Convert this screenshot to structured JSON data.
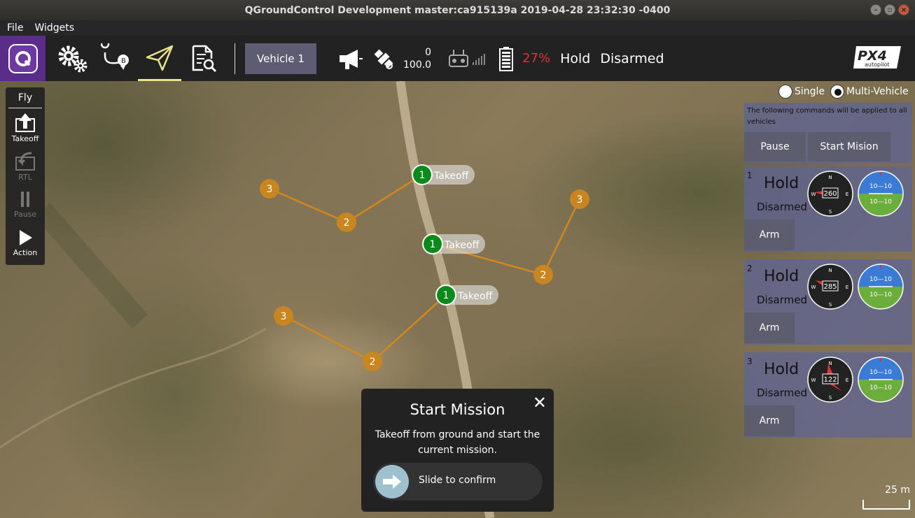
{
  "window": {
    "title": "QGroundControl Development master:ca915139a 2019-04-28 23:32:30 -0400"
  },
  "menu": {
    "file": "File",
    "widgets": "Widgets"
  },
  "toolbar": {
    "vehicle_selector": "Vehicle 1",
    "gps_count": "0",
    "gps_hdop": "100.0",
    "battery_percent": "27%",
    "flight_mode": "Hold",
    "arm_state": "Disarmed",
    "icons": [
      "qgc-logo-icon",
      "settings-gears-icon",
      "plan-route-icon",
      "fly-paper-plane-icon",
      "analyze-icon",
      "megaphone-icon",
      "gps-satellite-icon",
      "rc-transmitter-icon",
      "signal-bars-icon",
      "battery-icon",
      "px4-logo"
    ]
  },
  "flypanel": {
    "title": "Fly",
    "items": [
      {
        "label": "Takeoff",
        "icon": "takeoff-icon",
        "enabled": true
      },
      {
        "label": "RTL",
        "icon": "rtl-icon",
        "enabled": false
      },
      {
        "label": "Pause",
        "icon": "pause-icon",
        "enabled": false
      },
      {
        "label": "Action",
        "icon": "play-icon",
        "enabled": true
      }
    ]
  },
  "vehicle_mode_toggle": {
    "single": "Single",
    "multi": "Multi-Vehicle",
    "selected": "Multi-Vehicle"
  },
  "multi_vehicle": {
    "message": "The following commands will be applied to all vehicles",
    "pause": "Pause",
    "start": "Start Mision",
    "vehicles": [
      {
        "id": "1",
        "mode": "Hold",
        "state": "Disarmed",
        "heading": "260",
        "arm": "Arm",
        "attitude_top": "10—10",
        "attitude_bottom": "10—10"
      },
      {
        "id": "2",
        "mode": "Hold",
        "state": "Disarmed",
        "heading": "285",
        "arm": "Arm",
        "attitude_top": "10—10",
        "attitude_bottom": "10—10"
      },
      {
        "id": "3",
        "mode": "Hold",
        "state": "Disarmed",
        "heading": "122",
        "arm": "Arm",
        "attitude_top": "10—10",
        "attitude_bottom": "10—10"
      }
    ],
    "compass_letters": {
      "n": "N",
      "e": "E",
      "s": "S",
      "w": "W"
    }
  },
  "map": {
    "takeoff_label": "Takeoff",
    "waypoint_labels": [
      "1",
      "2",
      "3"
    ],
    "scale": "25 m",
    "colors": {
      "takeoff": "#0a8a1a",
      "waypoint": "#c9851f",
      "path": "#d4881c"
    }
  },
  "dialog": {
    "title": "Start Mission",
    "description": "Takeoff from ground and start the current mission.",
    "slider": "Slide to confirm",
    "close": "✕"
  }
}
